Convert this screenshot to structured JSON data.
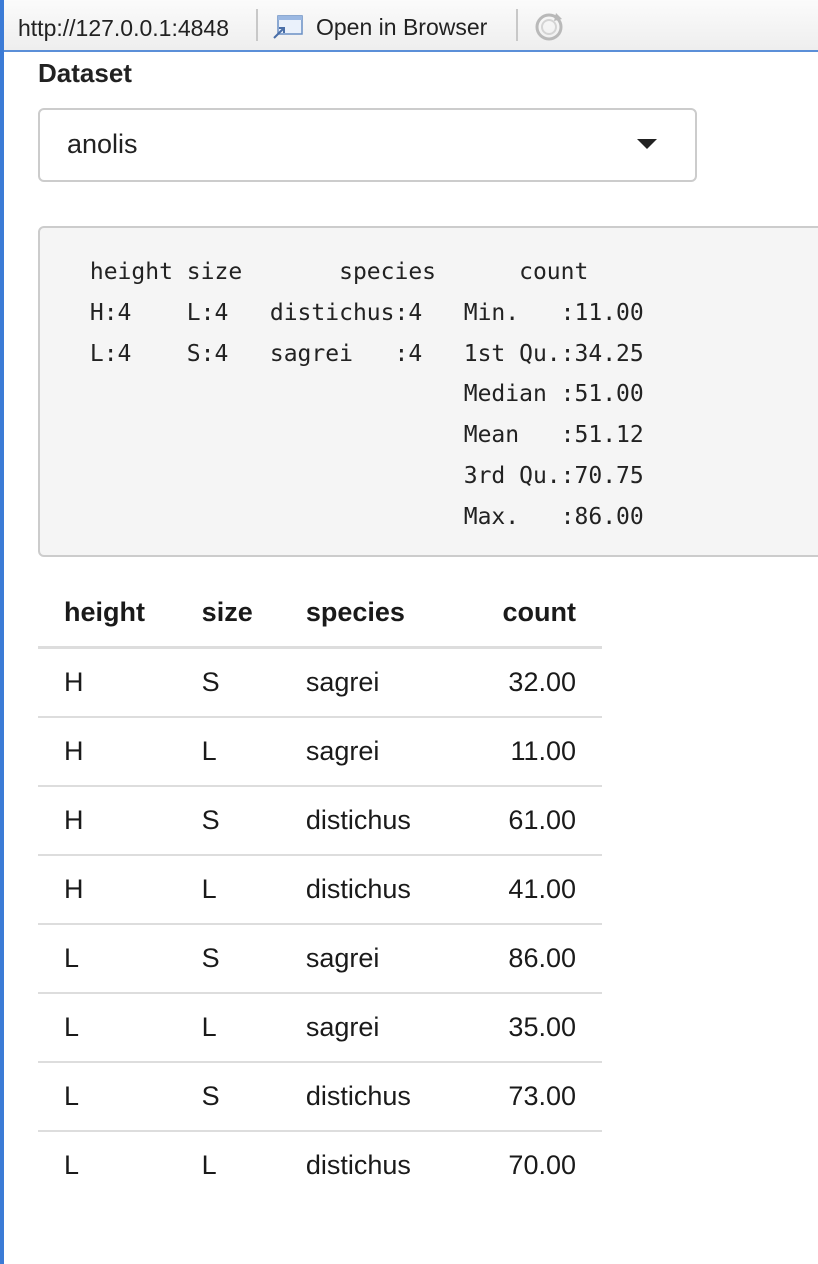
{
  "toolbar": {
    "url": "http://127.0.0.1:4848",
    "open_in_browser_label": "Open in Browser"
  },
  "icons": {
    "open_in_browser": "open-in-browser-icon",
    "refresh": "refresh-icon",
    "dropdown": "chevron-down-icon"
  },
  "dataset": {
    "label": "Dataset",
    "selected": "anolis"
  },
  "summary": {
    "text": " height size       species      count     \n H:4    L:4   distichus:4   Min.   :11.00  \n L:4    S:4   sagrei   :4   1st Qu.:34.25  \n                            Median :51.00  \n                            Mean   :51.12  \n                            3rd Qu.:70.75  \n                            Max.   :86.00  "
  },
  "table": {
    "headers": [
      "height",
      "size",
      "species",
      "count"
    ],
    "rows": [
      [
        "H",
        "S",
        "sagrei",
        "32.00"
      ],
      [
        "H",
        "L",
        "sagrei",
        "11.00"
      ],
      [
        "H",
        "S",
        "distichus",
        "61.00"
      ],
      [
        "H",
        "L",
        "distichus",
        "41.00"
      ],
      [
        "L",
        "S",
        "sagrei",
        "86.00"
      ],
      [
        "L",
        "L",
        "sagrei",
        "35.00"
      ],
      [
        "L",
        "S",
        "distichus",
        "73.00"
      ],
      [
        "L",
        "L",
        "distichus",
        "70.00"
      ]
    ]
  },
  "colors": {
    "accent": "#3b7bd6",
    "border": "#cccccc",
    "summary_bg": "#f5f5f5"
  }
}
